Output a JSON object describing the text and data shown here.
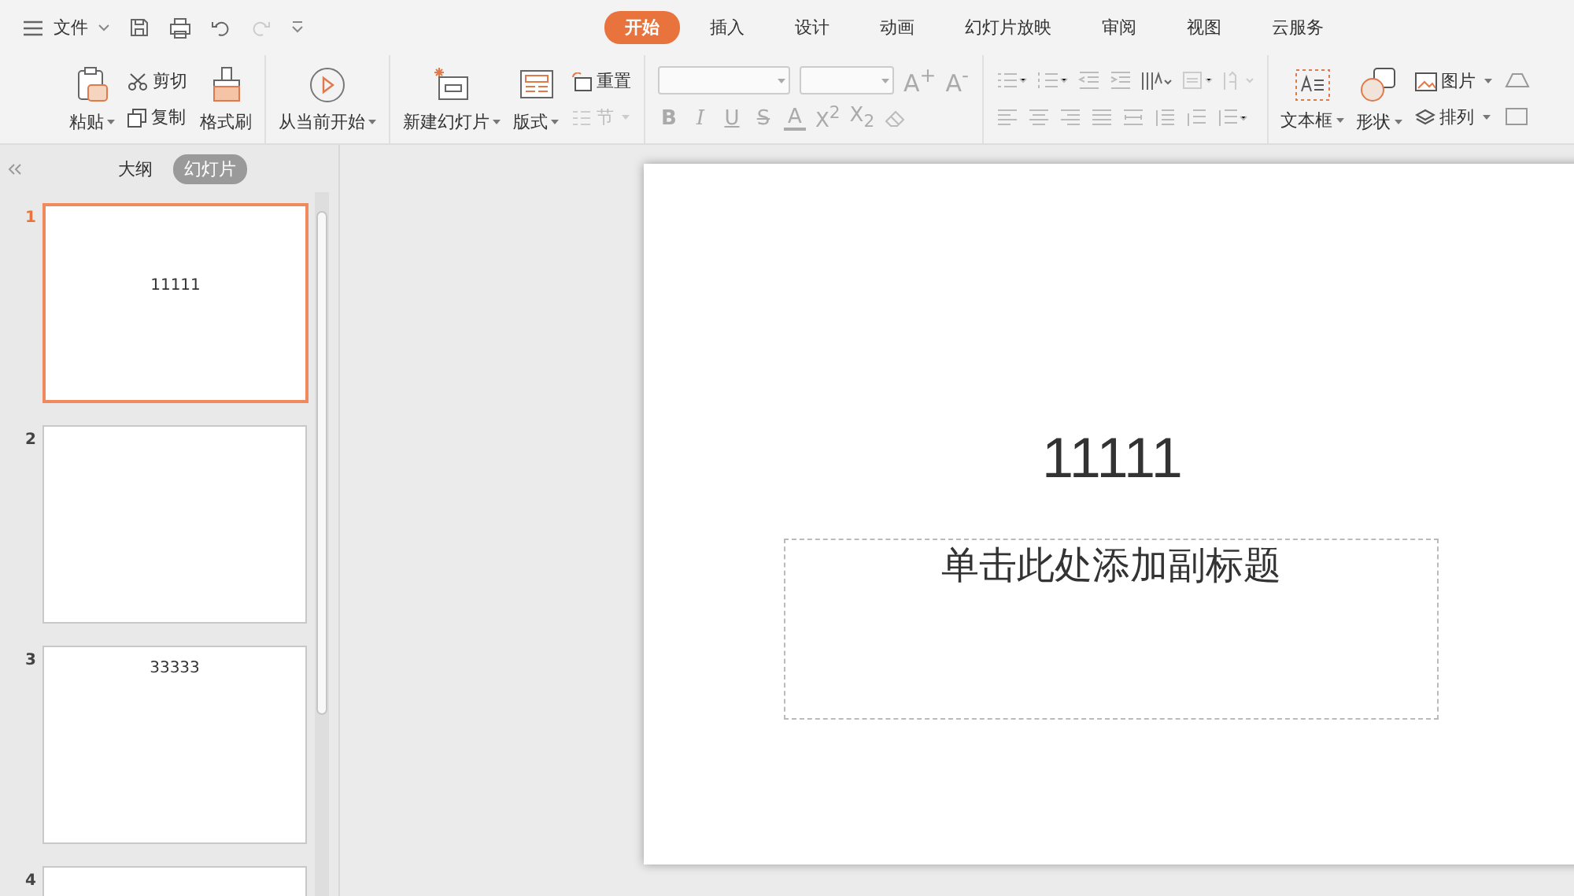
{
  "menu": {
    "label": "文件"
  },
  "tabs": [
    {
      "label": "开始",
      "selected": true
    },
    {
      "label": "插入",
      "selected": false
    },
    {
      "label": "设计",
      "selected": false
    },
    {
      "label": "动画",
      "selected": false
    },
    {
      "label": "幻灯片放映",
      "selected": false
    },
    {
      "label": "审阅",
      "selected": false
    },
    {
      "label": "视图",
      "selected": false
    },
    {
      "label": "云服务",
      "selected": false
    }
  ],
  "ribbon": {
    "clipboard": {
      "paste": "粘贴",
      "cut": "剪切",
      "copy": "复制",
      "format_painter": "格式刷"
    },
    "play": "从当前开始",
    "slides": {
      "new_slide": "新建幻灯片",
      "layout": "版式",
      "reset": "重置",
      "section": "节"
    },
    "font_size_buttons": [
      "A$^{+}$",
      "A$^{-}$"
    ],
    "format_buttons": [
      "B",
      "I",
      "U",
      "S",
      "A",
      "X$^{2}$",
      "X$_{2}$"
    ],
    "insert": {
      "text_box": "文本框",
      "shape": "形状",
      "picture": "图片",
      "arrange": "排列"
    }
  },
  "panel": {
    "tabs": [
      {
        "label": "大纲",
        "selected": false
      },
      {
        "label": "幻灯片",
        "selected": true
      }
    ],
    "slides": [
      {
        "number": "1",
        "text": "11111",
        "selected": true
      },
      {
        "number": "2",
        "selected": false
      },
      {
        "number": "3",
        "text": "33333",
        "selected": false
      },
      {
        "number": "4",
        "selected": false
      }
    ]
  },
  "slide": {
    "title": "11111",
    "subtitle_placeholder": "单击此处添加副标题"
  }
}
